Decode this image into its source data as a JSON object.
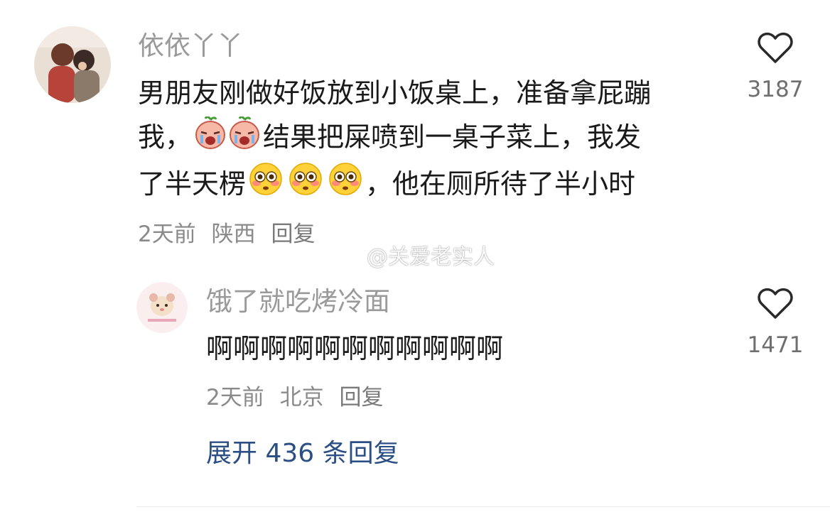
{
  "comment": {
    "username": "依依丫丫",
    "lines": [
      "男朋友刚做好饭放到小饭桌上，准备拿屁蹦",
      [
        "我，",
        "结果把屎喷到一桌子菜上，我发"
      ],
      [
        "了半天楞",
        "，他在厕所待了半小时"
      ]
    ],
    "time": "2天前",
    "location": "陕西",
    "reply_label": "回复",
    "like_count": "3187"
  },
  "reply": {
    "username": "饿了就吃烤冷面",
    "text": "啊啊啊啊啊啊啊啊啊啊啊",
    "time": "2天前",
    "location": "北京",
    "reply_label": "回复",
    "like_count": "1471"
  },
  "expand_label": "展开 436 条回复",
  "watermark": "@关爱老实人",
  "icons": {
    "like": "heart-outline-icon",
    "emoji_1": "crying-face-icon",
    "emoji_2": "flushed-face-icon"
  },
  "colors": {
    "link": "#2b4f84",
    "meta": "#8a8a8a",
    "username": "#9a9a9a"
  }
}
